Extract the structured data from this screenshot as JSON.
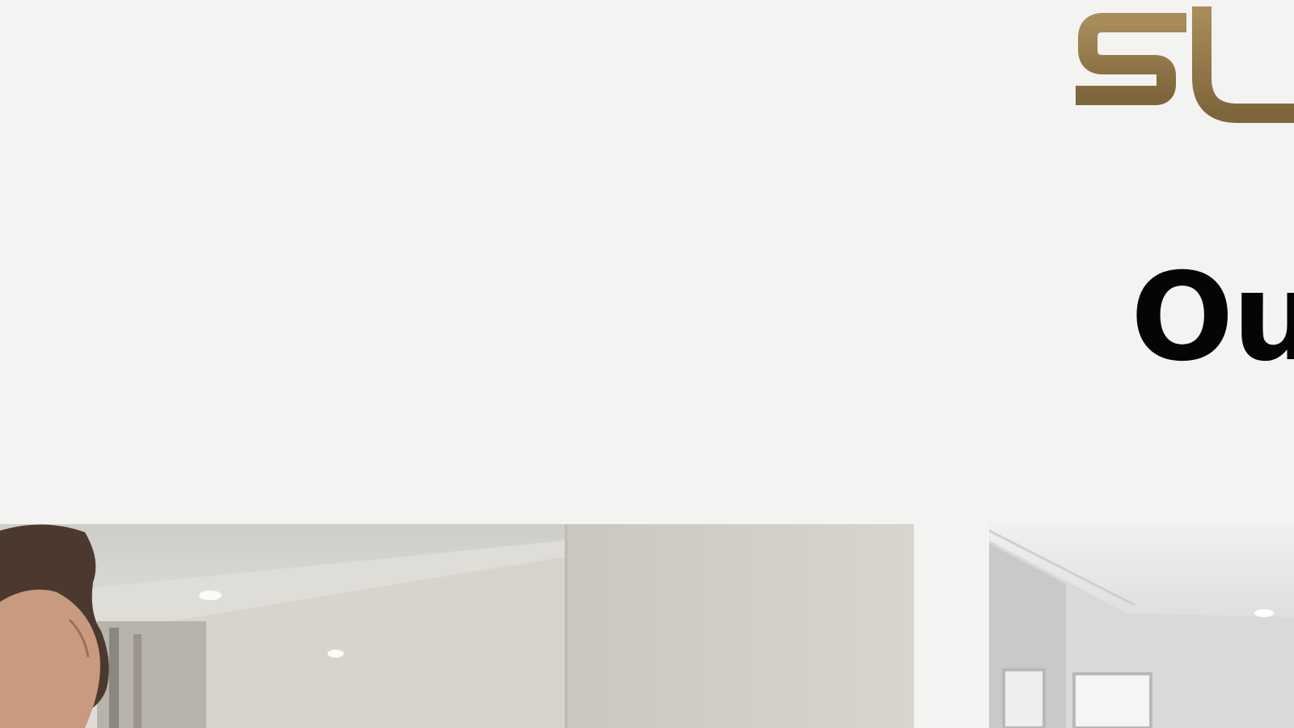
{
  "brand": {
    "logo_text": "SU",
    "accent_color": "#8e7345"
  },
  "section": {
    "heading": "Ou"
  },
  "gallery": {
    "images": [
      {
        "name": "man-in-modern-interior-photo"
      },
      {
        "name": "bright-interior-room-photo"
      }
    ]
  }
}
